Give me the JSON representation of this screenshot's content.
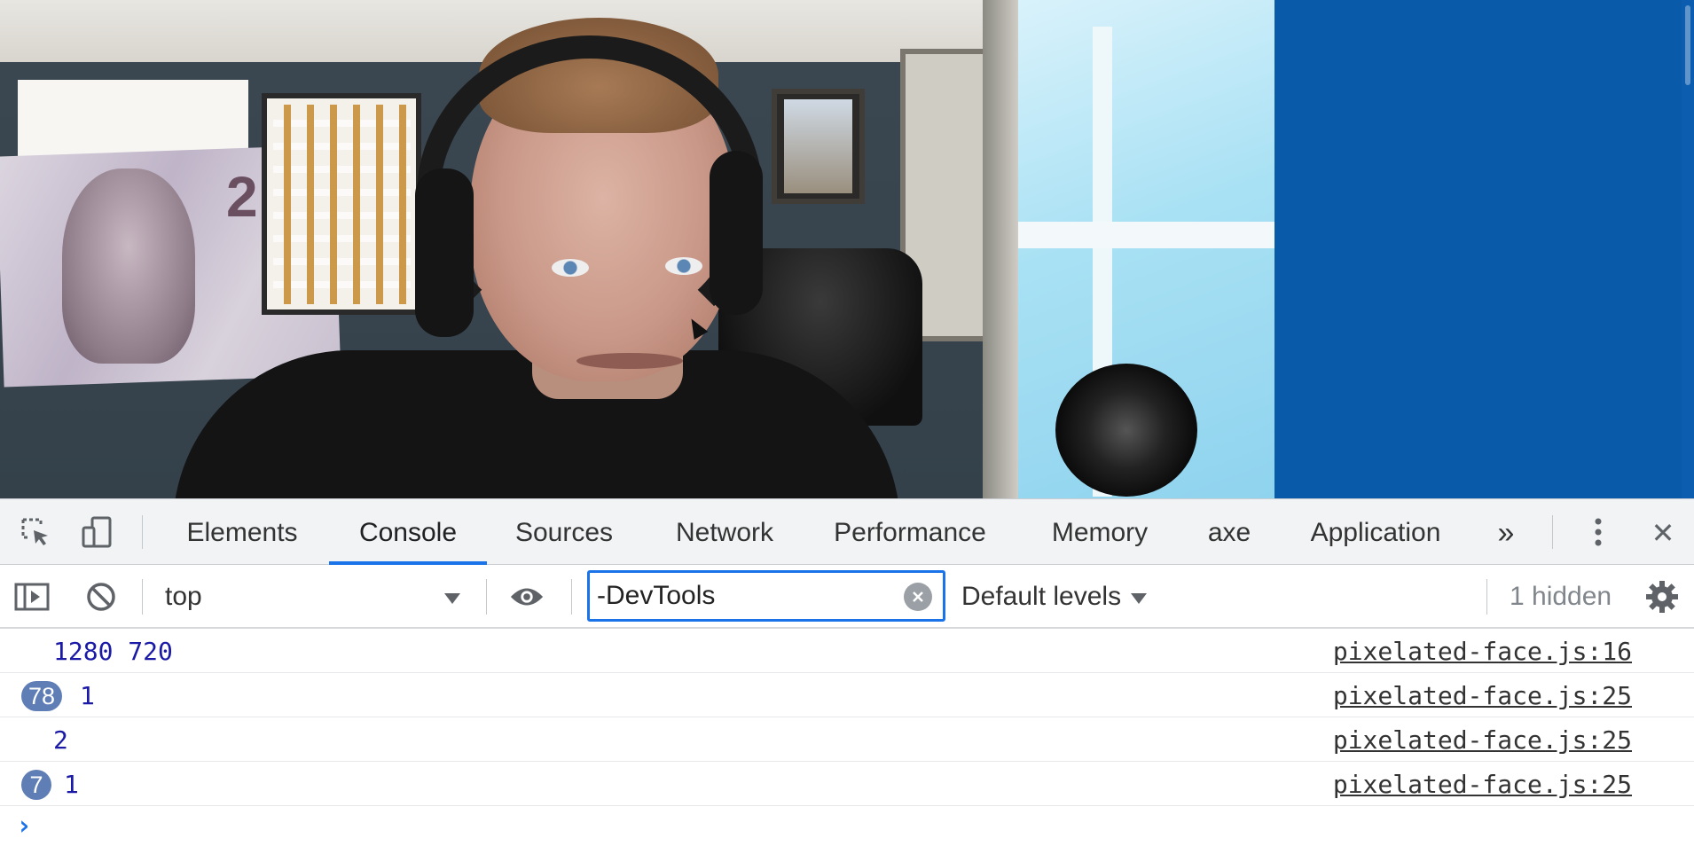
{
  "devtools": {
    "tabs": [
      {
        "label": "Elements"
      },
      {
        "label": "Console"
      },
      {
        "label": "Sources"
      },
      {
        "label": "Network"
      },
      {
        "label": "Performance"
      },
      {
        "label": "Memory"
      },
      {
        "label": "axe"
      },
      {
        "label": "Application"
      }
    ],
    "active_tab": "Console",
    "more_tabs_symbol": "»",
    "close_symbol": "✕"
  },
  "console_toolbar": {
    "context": "top",
    "filter_value": "-DevTools",
    "levels": "Default levels",
    "hidden": "1 hidden"
  },
  "console_messages": [
    {
      "count": "",
      "text": "1280 720",
      "source": "pixelated-face.js:16"
    },
    {
      "count": "78",
      "text": "1",
      "source": "pixelated-face.js:25"
    },
    {
      "count": "",
      "text": "2",
      "source": "pixelated-face.js:25"
    },
    {
      "count": "7",
      "text": "1",
      "source": "pixelated-face.js:25"
    }
  ],
  "prompt_symbol": "›",
  "viewport": {
    "banknote_number": "2",
    "page_background": "#0a5aaa"
  },
  "colors": {
    "accent": "#1a73e8",
    "badge": "#5f7eb6",
    "log_text": "#1a1aa6"
  }
}
